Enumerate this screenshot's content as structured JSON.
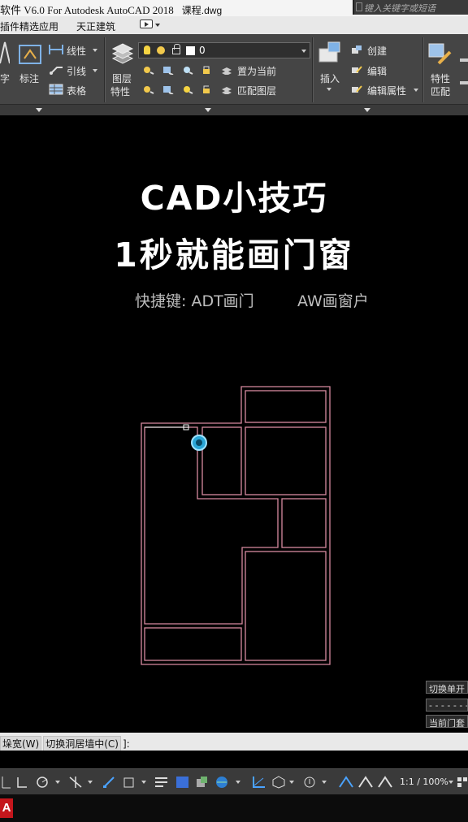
{
  "window": {
    "title": "软件 V6.0 For Autodesk AutoCAD 2018",
    "file": "课程.dwg",
    "search_placeholder": "键入关键字或短语"
  },
  "tabs": [
    "插件",
    "精选应用",
    "天正建筑"
  ],
  "ribbon": {
    "text_label": "字",
    "annotate_label": "标注",
    "linear_label": "线性",
    "leader_label": "引线",
    "table_label": "表格",
    "layer_props_label_1": "图层",
    "layer_props_label_2": "特性",
    "layer_name": "0",
    "set_current_label": "置为当前",
    "match_layer_label": "匹配图层",
    "insert_label": "插入",
    "create_label": "创建",
    "edit_label": "编辑",
    "edit_attr_label": "编辑属性",
    "match_props_label_1": "特性",
    "match_props_label_2": "匹配"
  },
  "canvas": {
    "heading_line1": "CAD小技巧",
    "heading_line2": "1秒就能画门窗",
    "shortcut_door": "快捷键: ADT画门",
    "shortcut_window": "AW画窗户"
  },
  "side_panel": {
    "toggle_label": "切换单开",
    "dashes": "- - - - - - - -",
    "current_label": "当前门套"
  },
  "command_line": {
    "opt1": "垛宽(W)",
    "opt2": "切换洞居墙中(C)",
    "suffix": "]:"
  },
  "status": {
    "zoom": "1:1 / 100%"
  },
  "colors": {
    "wall_line": "#d88aa0",
    "ribbon_bg": "#454545",
    "canvas_bg": "#000000",
    "cursor_ring": "#2aa6d6"
  }
}
